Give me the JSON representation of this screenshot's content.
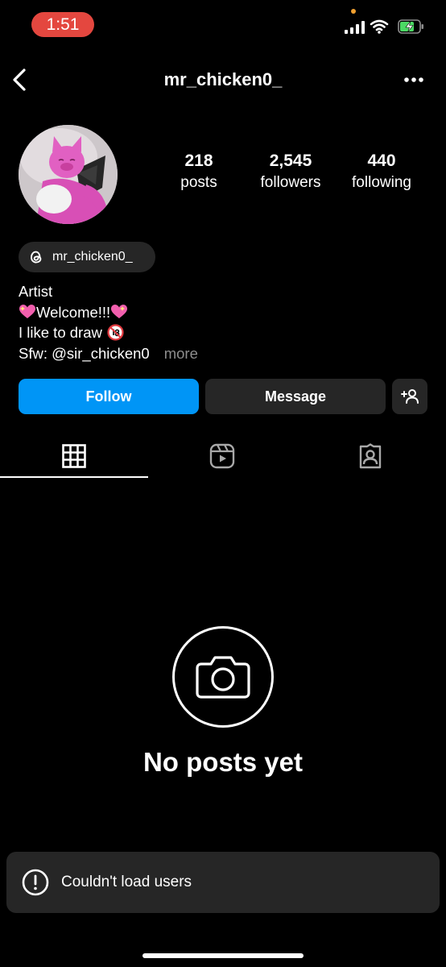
{
  "status_bar": {
    "time": "1:51",
    "time_pill_color": "#e4473f",
    "icons": [
      "signal-icon",
      "wifi-icon",
      "battery-charging-icon"
    ]
  },
  "header": {
    "username": "mr_chicken0_",
    "back_icon": "chevron-left-icon",
    "more_icon": "more-dots-icon"
  },
  "profile": {
    "stats": [
      {
        "value": "218",
        "label": "posts"
      },
      {
        "value": "2,545",
        "label": "followers"
      },
      {
        "value": "440",
        "label": "following"
      }
    ],
    "threads_handle": "mr_chicken0_",
    "bio": {
      "line1": "Artist",
      "line2_text": "Welcome!!!",
      "line3_text": "I like to draw",
      "line4_text": "Sfw: @sir_chicken0",
      "more": "more"
    }
  },
  "actions": {
    "follow": "Follow",
    "message": "Message",
    "follow_color": "#0095f6",
    "add_user_icon": "add-user-icon"
  },
  "tabs": [
    {
      "icon": "grid-icon",
      "active": true
    },
    {
      "icon": "reels-icon",
      "active": false
    },
    {
      "icon": "tagged-icon",
      "active": false
    }
  ],
  "empty_state": {
    "icon": "camera-icon",
    "title": "No posts yet"
  },
  "toast": {
    "icon": "alert-icon",
    "text": "Couldn't load users"
  }
}
